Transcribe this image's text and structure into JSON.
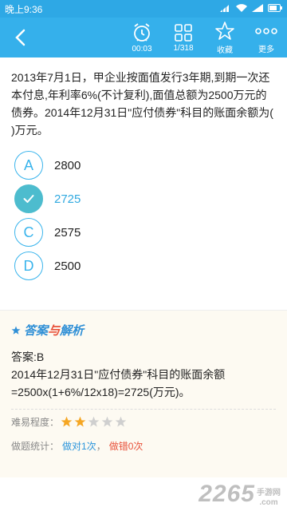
{
  "status": {
    "time": "晚上9:36"
  },
  "toolbar": {
    "timer_label": "00:03",
    "progress_label": "1/318",
    "favorite_label": "收藏",
    "more_label": "更多"
  },
  "question": {
    "text": "2013年7月1日，甲企业按面值发行3年期,到期一次还本付息,年利率6%(不计复利),面值总额为2500万元的债券。2014年12月31日\"应付债券\"科目的账面余额为( )万元。"
  },
  "options": [
    {
      "letter": "A",
      "value": "2800"
    },
    {
      "letter": "",
      "value": "2725"
    },
    {
      "letter": "C",
      "value": "2575"
    },
    {
      "letter": "D",
      "value": "2500"
    }
  ],
  "answer": {
    "title_part1": "答案",
    "title_part2": "与",
    "title_part3": "解析",
    "answer_line": "答案:B",
    "explanation": "2014年12月31日\"应付债券\"科目的账面余额=2500x(1+6%/12x18)=2725(万元)。",
    "difficulty_label": "难易程度：",
    "difficulty_rating": 2,
    "difficulty_max": 5,
    "stats_label": "做题统计：",
    "correct_label": "做对1次",
    "separator": "，",
    "wrong_label": "做错0次"
  },
  "watermark": {
    "big": "2265",
    "small_line1": "手游网",
    "small_line2": ".com"
  }
}
